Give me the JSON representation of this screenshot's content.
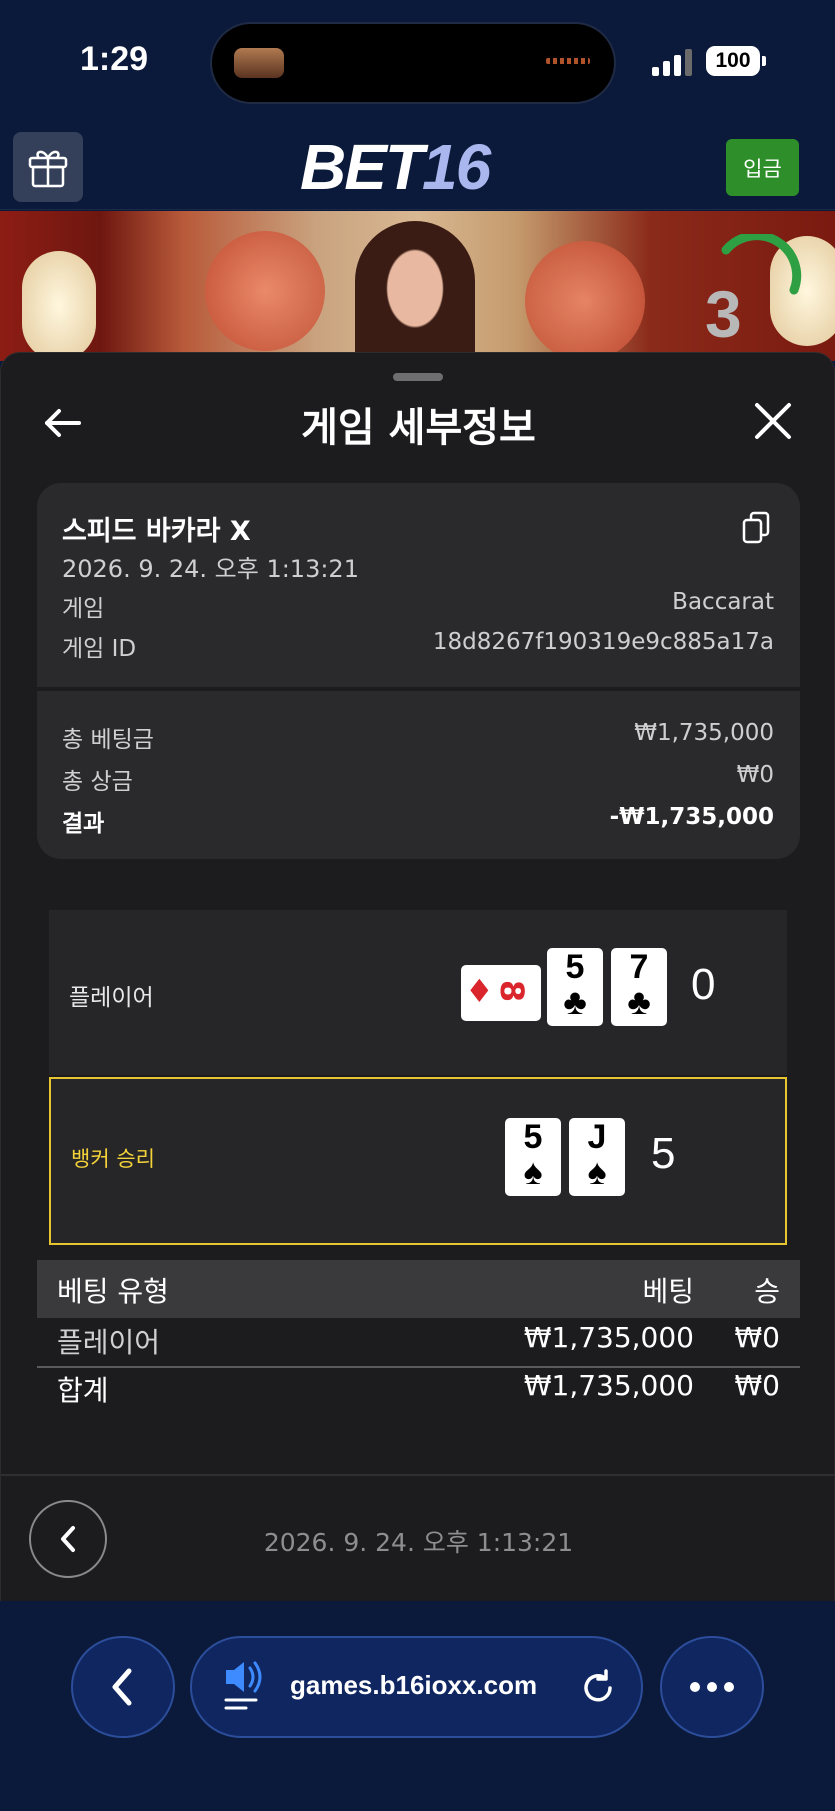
{
  "status_bar": {
    "time": "1:29",
    "battery": "100"
  },
  "header": {
    "logo_part1": "BET",
    "logo_part2": "16",
    "deposit_label": "입금"
  },
  "video": {
    "countdown": "3"
  },
  "sheet": {
    "title": "게임 세부정보"
  },
  "game_info": {
    "name": "스피드 바카라 X",
    "datetime": "2026. 9. 24. 오후 1:13:21",
    "game_label": "게임",
    "game_value": "Baccarat",
    "id_label": "게임 ID",
    "id_value": "18d8267f190319e9c885a17a"
  },
  "summary": {
    "total_bet_label": "총 베팅금",
    "total_bet_value": "₩1,735,000",
    "total_win_label": "총 상금",
    "total_win_value": "₩0",
    "result_label": "결과",
    "result_value": "-₩1,735,000"
  },
  "hands": {
    "player": {
      "label": "플레이어",
      "side_card": {
        "suit": "♦",
        "rank": "8"
      },
      "cards": [
        {
          "rank": "5",
          "suit": "♣"
        },
        {
          "rank": "7",
          "suit": "♣"
        }
      ],
      "score": "0"
    },
    "banker": {
      "label": "뱅커 승리",
      "cards": [
        {
          "rank": "5",
          "suit": "♠"
        },
        {
          "rank": "J",
          "suit": "♠"
        }
      ],
      "score": "5"
    }
  },
  "bet_table": {
    "headers": {
      "type": "베팅 유형",
      "bet": "베팅",
      "win": "승"
    },
    "rows": [
      {
        "type": "플레이어",
        "bet": "₩1,735,000",
        "win": "₩0"
      }
    ],
    "total": {
      "type": "합계",
      "bet": "₩1,735,000",
      "win": "₩0"
    }
  },
  "footer": {
    "datetime": "2026. 9. 24. 오후 1:13:21"
  },
  "browser": {
    "url": "games.b16ioxx.com"
  },
  "colors": {
    "background": "#0b1a3a",
    "sheet": "#1c1c1e",
    "card": "#2a2a2c",
    "deposit": "#2e8f2a",
    "winner_border": "#e6c531",
    "red_suit": "#d9252b"
  },
  "icons": [
    "gift-icon",
    "back-arrow-icon",
    "close-icon",
    "copy-icon",
    "chevron-left-icon",
    "speaker-icon",
    "reload-icon",
    "more-icon",
    "signal-icon",
    "battery-icon"
  ]
}
